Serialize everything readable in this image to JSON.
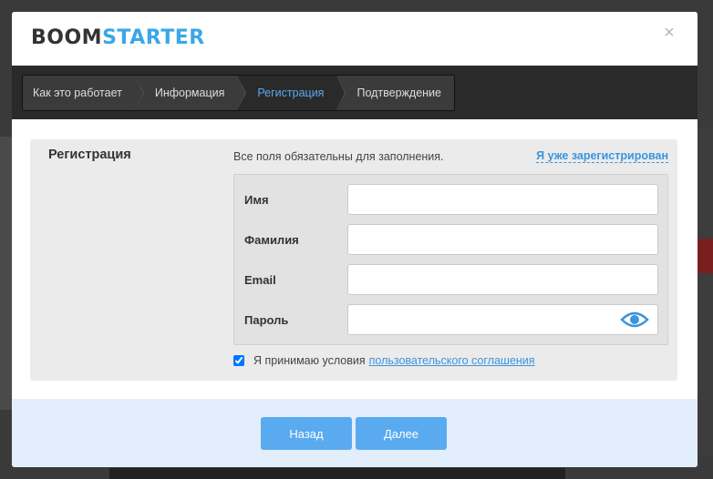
{
  "logo": {
    "part1": "BOOM",
    "part2": "STARTER"
  },
  "close_label": "×",
  "steps": [
    {
      "label": "Как это работает",
      "active": false
    },
    {
      "label": "Информация",
      "active": false
    },
    {
      "label": "Регистрация",
      "active": true
    },
    {
      "label": "Подтверждение",
      "active": false
    }
  ],
  "form": {
    "title": "Регистрация",
    "note": "Все поля обязательны для заполнения.",
    "login_link": "Я уже зарегистрирован",
    "fields": [
      {
        "label": "Имя",
        "value": ""
      },
      {
        "label": "Фамилия",
        "value": ""
      },
      {
        "label": "Email",
        "value": ""
      },
      {
        "label": "Пароль",
        "value": ""
      }
    ],
    "agree_text": "Я принимаю условия",
    "agree_link": "пользовательского соглашения",
    "agree_checked": true
  },
  "buttons": {
    "back": "Назад",
    "next": "Далее"
  },
  "colors": {
    "accent": "#5aaaf0",
    "link": "#3b95dc",
    "logo_blue": "#3ba7e6"
  }
}
